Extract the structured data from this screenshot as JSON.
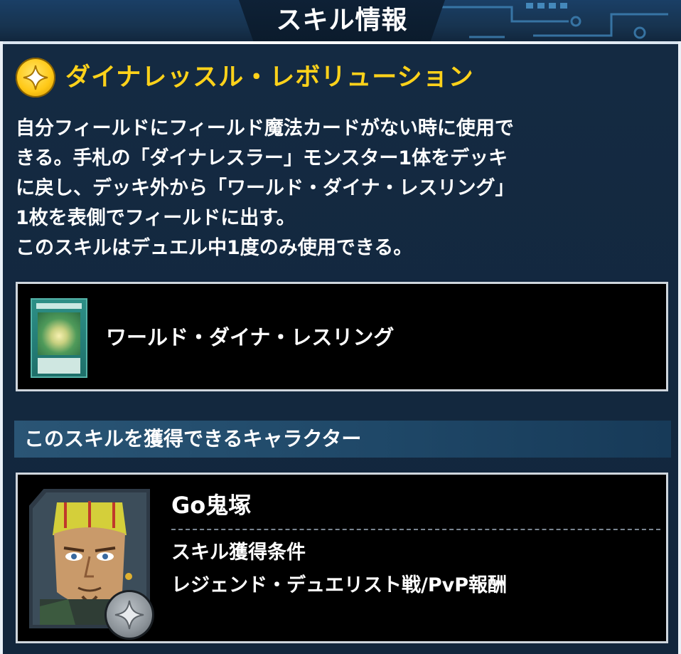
{
  "header": {
    "title": "スキル情報"
  },
  "skill": {
    "icon": "sparkle-icon",
    "name": "ダイナレッスル・レボリューション",
    "description_lines": [
      "自分フィールドにフィールド魔法カードがない時に使用で",
      "きる。手札の「ダイナレスラー」モンスター1体をデッキ",
      "に戻し、デッキ外から「ワールド・ダイナ・レスリング」",
      "1枚を表側でフィールドに出す。",
      "このスキルはデュエル中1度のみ使用できる。"
    ]
  },
  "related_card": {
    "name": "ワールド・ダイナ・レスリング"
  },
  "characters_section": {
    "title": "このスキルを獲得できるキャラクター"
  },
  "character": {
    "name": "Go鬼塚",
    "condition_label": "スキル獲得条件",
    "condition_value": "レジェンド・デュエリスト戦/PvP報酬"
  },
  "colors": {
    "accent_gold": "#ffd21a",
    "panel_bg": "#12263c",
    "border_light": "#cfd6dd"
  }
}
